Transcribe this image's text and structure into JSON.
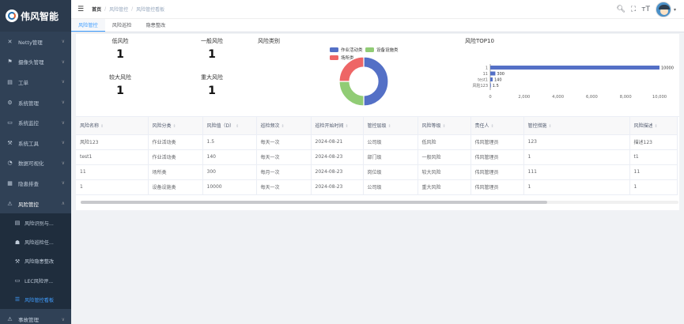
{
  "app": {
    "title": "伟风智能"
  },
  "sidebar": {
    "items": [
      {
        "label": "Netty管理",
        "icon": "✕",
        "icon_name": "netty-icon"
      },
      {
        "label": "摄像头管理",
        "icon": "⚑",
        "icon_name": "camera-icon"
      },
      {
        "label": "工单",
        "icon": "▤",
        "icon_name": "workorder-icon"
      },
      {
        "label": "系统管理",
        "icon": "⚙",
        "icon_name": "gear-icon"
      },
      {
        "label": "系统监控",
        "icon": "▭",
        "icon_name": "monitor-icon"
      },
      {
        "label": "系统工具",
        "icon": "⚒",
        "icon_name": "tools-icon"
      },
      {
        "label": "数据可视化",
        "icon": "◔",
        "icon_name": "chart-icon"
      },
      {
        "label": "隐患排查",
        "icon": "▦",
        "icon_name": "inspection-icon"
      },
      {
        "label": "风险管控",
        "icon": "⚠",
        "icon_name": "risk-icon",
        "open": true
      }
    ],
    "subitems": [
      {
        "label": "风险识别与...",
        "icon": "▤",
        "icon_name": "doc-icon"
      },
      {
        "label": "风险巡检任...",
        "icon": "☗",
        "icon_name": "home-icon"
      },
      {
        "label": "风险隐患整改",
        "icon": "⚒",
        "icon_name": "fix-icon"
      },
      {
        "label": "LEC风险评...",
        "icon": "▭",
        "icon_name": "lec-icon"
      },
      {
        "label": "风险管控看板",
        "icon": "☰",
        "icon_name": "list-icon",
        "active": true
      }
    ],
    "after": [
      {
        "label": "事故管理",
        "icon": "⚠",
        "icon_name": "accident-icon"
      }
    ]
  },
  "header": {
    "breadcrumb": [
      "首页",
      "风险管控",
      "风险管控看板"
    ]
  },
  "tabs": [
    "风险管控",
    "风险巡检",
    "隐患整改"
  ],
  "stats": {
    "low": {
      "label": "低风险",
      "value": "1"
    },
    "normal": {
      "label": "一般风险",
      "value": "1"
    },
    "higher": {
      "label": "较大风险",
      "value": "1"
    },
    "major": {
      "label": "重大风险",
      "value": "1"
    }
  },
  "chart_data": [
    {
      "type": "pie",
      "title": "风险类别",
      "categories": [
        "作业活动类",
        "设备设施类",
        "场所类"
      ],
      "values": [
        2,
        1,
        1
      ],
      "colors": [
        "#5470c6",
        "#91cc75",
        "#ee6666"
      ],
      "legend": "top"
    },
    {
      "type": "bar",
      "orientation": "horizontal",
      "title": "风险TOP10",
      "categories": [
        "1",
        "11",
        "test1",
        "风险123"
      ],
      "values": [
        10000,
        300,
        140,
        1.5
      ],
      "xlim": [
        0,
        10000
      ],
      "xticks": [
        "0",
        "2,000",
        "4,000",
        "6,000",
        "8,000",
        "10,000"
      ],
      "color": "#5470c6"
    }
  ],
  "table": {
    "columns": [
      "风险名称",
      "风险分类",
      "风险值（D）",
      "巡检频次",
      "巡检开始时间",
      "管控层级",
      "风险等级",
      "责任人",
      "管控措施",
      "风险描述"
    ],
    "rows": [
      [
        "风险123",
        "作业活动类",
        "1.5",
        "每天一次",
        "2024-08-21",
        "公司级",
        "低风险",
        "伟风管理员",
        "123",
        "描述123"
      ],
      [
        "test1",
        "作业活动类",
        "140",
        "每天一次",
        "2024-08-23",
        "部门级",
        "一般风险",
        "伟风管理员",
        "1",
        "t1"
      ],
      [
        "11",
        "场所类",
        "300",
        "每月一次",
        "2024-08-23",
        "岗位级",
        "较大风险",
        "伟风管理员",
        "111",
        "11"
      ],
      [
        "1",
        "设备设施类",
        "10000",
        "每天一次",
        "2024-08-23",
        "公司级",
        "重大风险",
        "伟风管理员",
        "1",
        "1"
      ]
    ]
  }
}
